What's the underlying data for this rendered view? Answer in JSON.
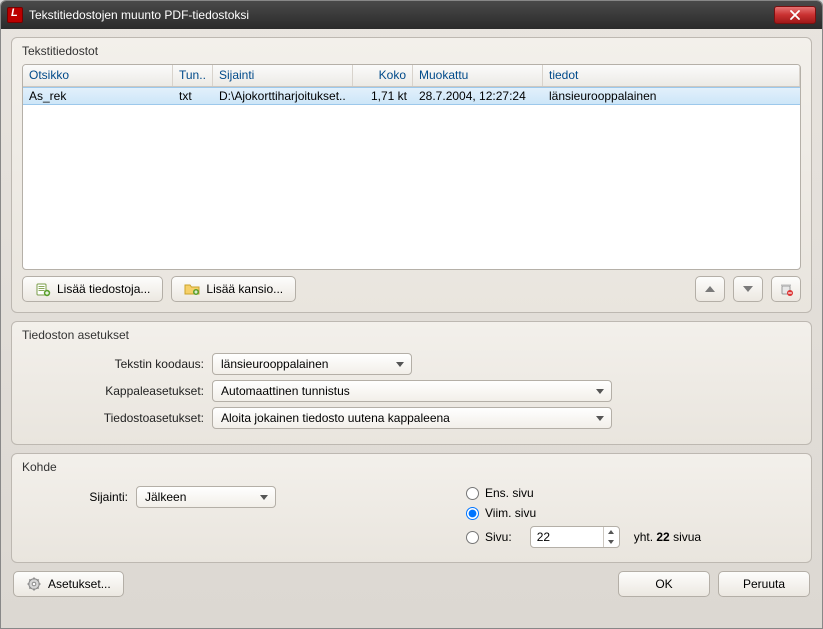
{
  "window": {
    "title": "Tekstitiedostojen muunto PDF-tiedostoksi"
  },
  "files_panel": {
    "legend": "Tekstitiedostot",
    "columns": {
      "title": "Otsikko",
      "ext": "Tun..",
      "location": "Sijainti",
      "size": "Koko",
      "modified": "Muokattu",
      "info": "tiedot"
    },
    "rows": [
      {
        "title": "As_rek",
        "ext": "txt",
        "location": "D:\\Ajokorttiharjoitukset..",
        "size": "1,71 kt",
        "modified": "28.7.2004, 12:27:24",
        "info": "länsieurooppalainen"
      }
    ],
    "buttons": {
      "add_files": "Lisää tiedostoja...",
      "add_folder": "Lisää kansio..."
    }
  },
  "file_settings": {
    "legend": "Tiedoston asetukset",
    "labels": {
      "encoding": "Tekstin koodaus:",
      "paragraph": "Kappaleasetukset:",
      "filemode": "Tiedostoasetukset:"
    },
    "values": {
      "encoding": "länsieurooppalainen",
      "paragraph": "Automaattinen tunnistus",
      "filemode": "Aloita jokainen tiedosto uutena kappaleena"
    }
  },
  "dest": {
    "legend": "Kohde",
    "labels": {
      "location": "Sijainti:",
      "first_page": "Ens. sivu",
      "last_page": "Viim. sivu",
      "page": "Sivu:",
      "total_prefix": "yht. ",
      "total_suffix": " sivua",
      "total_count": "22"
    },
    "values": {
      "location": "Jälkeen",
      "page_number": "22"
    }
  },
  "footer": {
    "settings": "Asetukset...",
    "ok": "OK",
    "cancel": "Peruuta"
  }
}
